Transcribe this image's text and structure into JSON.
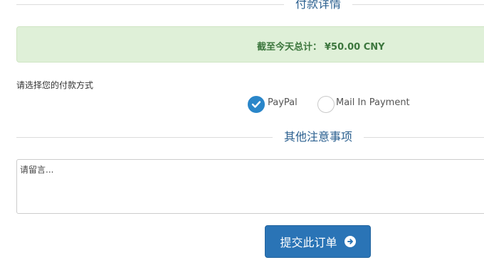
{
  "payment_section": {
    "title": "付款详情",
    "total_label": "截至今天总计：",
    "total_amount": "¥50.00 CNY"
  },
  "payment_method": {
    "label": "请选择您的付款方式",
    "options": [
      {
        "label": "PayPal",
        "selected": true
      },
      {
        "label": "Mail In Payment",
        "selected": false
      }
    ]
  },
  "notes_section": {
    "title": "其他注意事项",
    "placeholder": "请留言..."
  },
  "submit": {
    "label": "提交此订单"
  },
  "colors": {
    "accent": "#2a74b6",
    "success_bg": "#dff0d8",
    "success_text": "#3c763d"
  }
}
